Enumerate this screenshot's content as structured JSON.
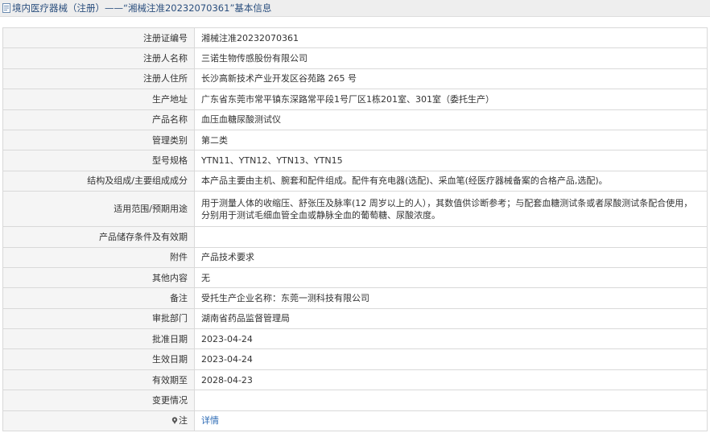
{
  "header": {
    "title": "境内医疗器械（注册）——“湘械注准20232070361”基本信息",
    "icon": "document-icon"
  },
  "rows": [
    {
      "label": "注册证编号",
      "value": "湘械注准20232070361"
    },
    {
      "label": "注册人名称",
      "value": "三诺生物传感股份有限公司"
    },
    {
      "label": "注册人住所",
      "value": "长沙高新技术产业开发区谷苑路 265 号"
    },
    {
      "label": "生产地址",
      "value": "广东省东莞市常平镇东深路常平段1号厂区1栋201室、301室（委托生产）"
    },
    {
      "label": "产品名称",
      "value": "血压血糖尿酸测试仪"
    },
    {
      "label": "管理类别",
      "value": "第二类"
    },
    {
      "label": "型号规格",
      "value": "YTN11、YTN12、YTN13、YTN15"
    },
    {
      "label": "结构及组成/主要组成成分",
      "value": "本产品主要由主机、腕套和配件组成。配件有充电器(选配)、采血笔(经医疗器械备案的合格产品,选配)。"
    },
    {
      "label": "适用范围/预期用途",
      "value": "用于测量人体的收缩压、舒张压及脉率(12 周岁以上的人），其数值供诊断参考；与配套血糖测试条或者尿酸测试条配合使用，分别用于测试毛细血管全血或静脉全血的葡萄糖、尿酸浓度。"
    },
    {
      "label": "产品储存条件及有效期",
      "value": ""
    },
    {
      "label": "附件",
      "value": "产品技术要求"
    },
    {
      "label": "其他内容",
      "value": "无"
    },
    {
      "label": "备注",
      "value": "受托生产企业名称：东莞一测科技有限公司"
    },
    {
      "label": "审批部门",
      "value": "湖南省药品监督管理局"
    },
    {
      "label": "批准日期",
      "value": "2023-04-24"
    },
    {
      "label": "生效日期",
      "value": "2023-04-24"
    },
    {
      "label": "有效期至",
      "value": "2028-04-23"
    },
    {
      "label": "变更情况",
      "value": ""
    }
  ],
  "note": {
    "label": "注",
    "icon": "pin-icon",
    "link": "详情"
  }
}
